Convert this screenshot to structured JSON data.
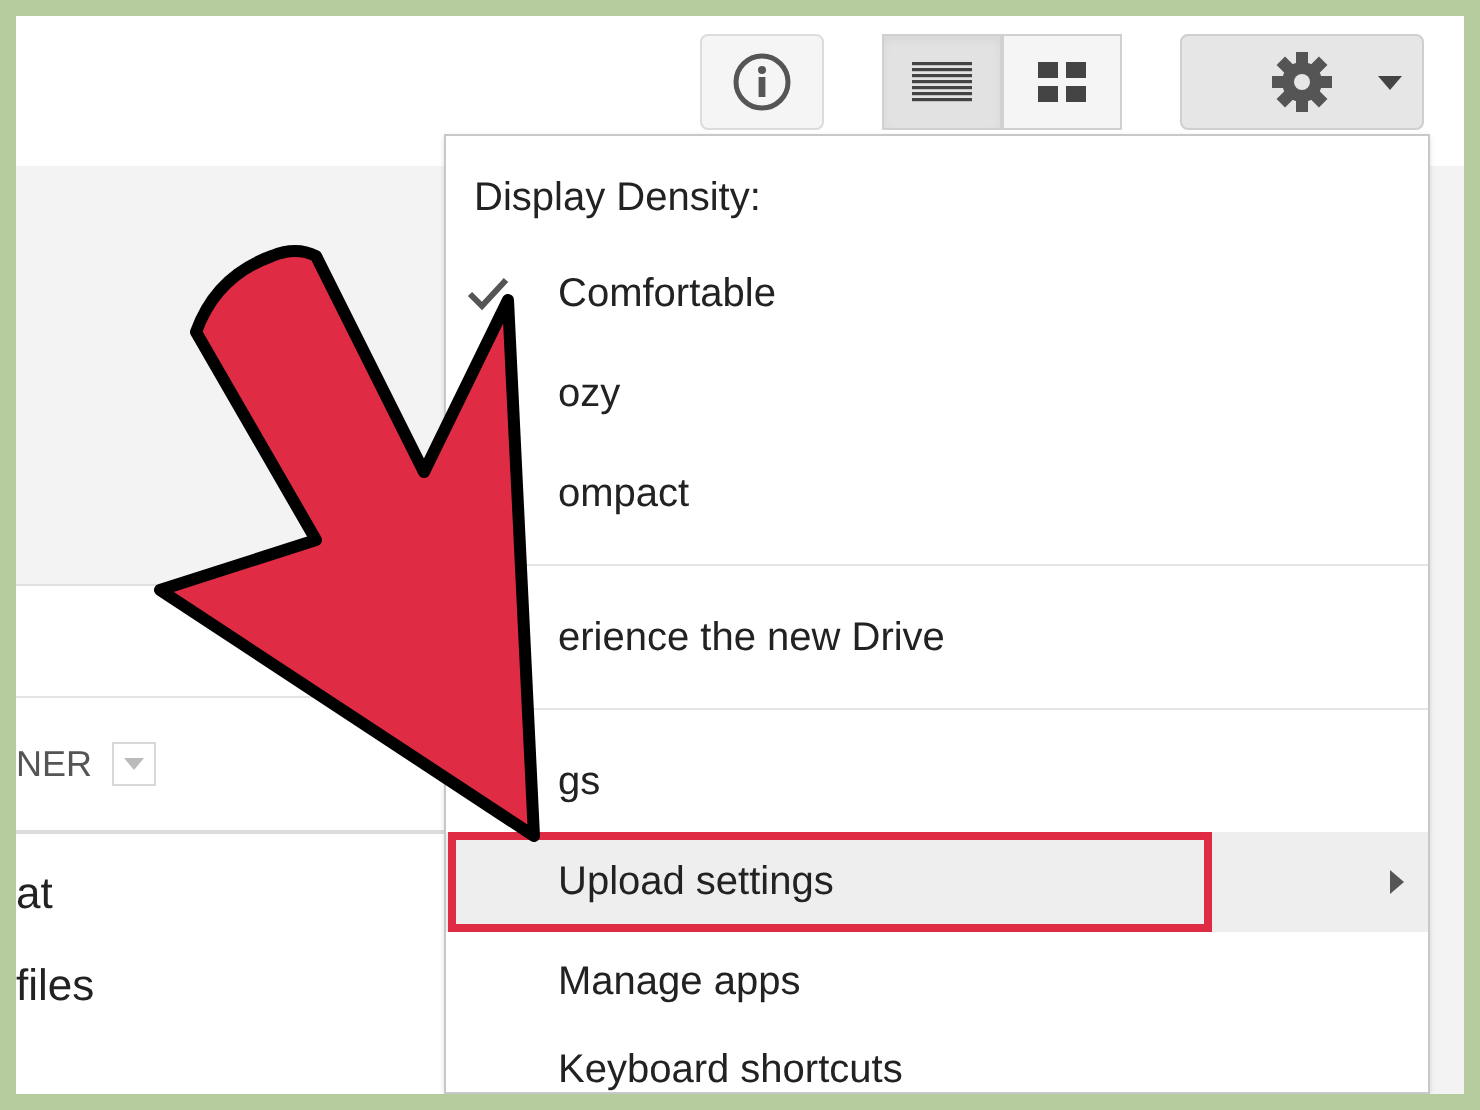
{
  "view_toggle": [
    {
      "kind": "list",
      "selected": true
    },
    {
      "kind": "grid",
      "selected": false
    }
  ],
  "file_list": {
    "columns": [
      {
        "label": "NER",
        "sortable": true
      }
    ],
    "rows": [
      "at",
      "files"
    ]
  },
  "settings_menu": {
    "heading": "Display Density:",
    "items": [
      {
        "kind": "option",
        "label": "Comfortable",
        "checked": true
      },
      {
        "kind": "option",
        "label": "ozy",
        "checked": false
      },
      {
        "kind": "option",
        "label": "ompact",
        "checked": false
      },
      {
        "kind": "divider"
      },
      {
        "kind": "item",
        "label": "erience the new Drive"
      },
      {
        "kind": "divider"
      },
      {
        "kind": "item",
        "label": "gs"
      },
      {
        "kind": "item",
        "label": "Upload settings",
        "selected": true,
        "has_submenu": true,
        "annotated": true
      },
      {
        "kind": "item",
        "label": "Manage apps"
      },
      {
        "kind": "item",
        "label": "Keyboard shortcuts"
      }
    ]
  }
}
